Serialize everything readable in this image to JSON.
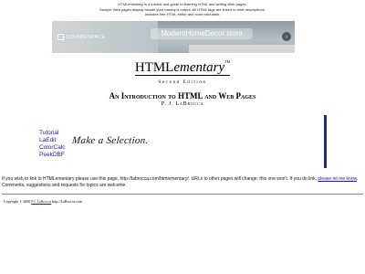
{
  "intro": {
    "line1": "HTMLementary is a tutorial and guide to learning HTML and writing Web pages.",
    "line2": "Sample Web pages display beside your markup's output. All HTML tags are linked to brief descriptions.",
    "line3": "Includes free HTML editor and color calculator."
  },
  "ad": {
    "brand": "SQUARESPACE",
    "store": "ModernHomeDecor.store",
    "arrow": "›"
  },
  "logo": {
    "html": "HTML",
    "ementary": "ementary",
    "tm": "TM"
  },
  "edition": "Second Edition",
  "subtitle": "An Introduction to HTML and Web Pages",
  "author": "P. J. LaBrocca",
  "nav": {
    "items": [
      "Tutorial",
      "LaEdit",
      "ColorCalc",
      "PeekDBF"
    ]
  },
  "make_selection": "Make a Selection.",
  "link_para": {
    "text": "If you wish to link to HTMLementary please use this page, http://labrocca.com/htmlementary/. URLs to other pages will change; this one won't. If you do link,",
    "link": "please let me know",
    "text2": ". Comments, suggestions and requests for topics are welcome."
  },
  "copyright": {
    "prefix": "Copyright © 2000",
    "author_link": "P.J. LaBrocca",
    "suffix": "http://LaBrocca.com"
  },
  "colors": {
    "link": "#1a1aa6",
    "bar": "#1a2a8a"
  }
}
